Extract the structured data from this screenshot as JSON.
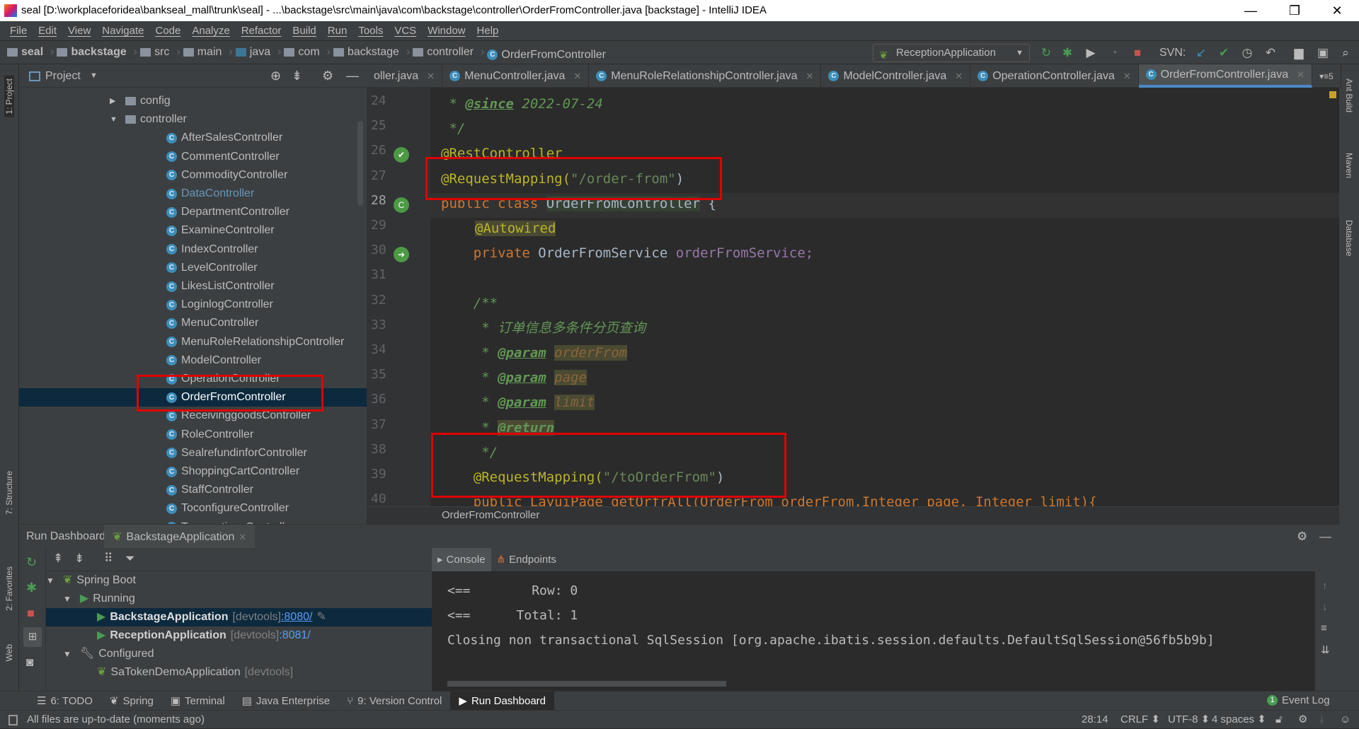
{
  "window": {
    "title": "seal [D:\\workplaceforidea\\bankseal_mall\\trunk\\seal] - ...\\backstage\\src\\main\\java\\com\\backstage\\controller\\OrderFromController.java [backstage] - IntelliJ IDEA",
    "minimize": "—",
    "restore": "❐",
    "close": "✕"
  },
  "menu": [
    "File",
    "Edit",
    "View",
    "Navigate",
    "Code",
    "Analyze",
    "Refactor",
    "Build",
    "Run",
    "Tools",
    "VCS",
    "Window",
    "Help"
  ],
  "breadcrumb": [
    "seal",
    "backstage",
    "src",
    "main",
    "java",
    "com",
    "backstage",
    "controller",
    "OrderFromController"
  ],
  "toolbar": {
    "run_config": "ReceptionApplication",
    "svn_label": "SVN:"
  },
  "left_strip": {
    "project": "1: Project",
    "structure": "7: Structure",
    "favorites": "2: Favorites",
    "web": "Web"
  },
  "right_strip": {
    "ant": "Ant Build",
    "maven": "Maven",
    "database": "Database"
  },
  "project_panel": {
    "title": "Project",
    "tree": [
      {
        "label": "config",
        "type": "folder",
        "depth": 1,
        "expanded": false
      },
      {
        "label": "controller",
        "type": "folder",
        "depth": 1,
        "expanded": true
      },
      {
        "label": "AfterSalesController",
        "type": "class",
        "depth": 2
      },
      {
        "label": "CommentController",
        "type": "class",
        "depth": 2
      },
      {
        "label": "CommodityController",
        "type": "class",
        "depth": 2
      },
      {
        "label": "DataController",
        "type": "class",
        "depth": 2,
        "color": "#6897bb"
      },
      {
        "label": "DepartmentController",
        "type": "class",
        "depth": 2
      },
      {
        "label": "ExamineController",
        "type": "class",
        "depth": 2
      },
      {
        "label": "IndexController",
        "type": "class",
        "depth": 2
      },
      {
        "label": "LevelController",
        "type": "class",
        "depth": 2
      },
      {
        "label": "LikesListController",
        "type": "class",
        "depth": 2
      },
      {
        "label": "LoginlogController",
        "type": "class",
        "depth": 2
      },
      {
        "label": "MenuController",
        "type": "class",
        "depth": 2
      },
      {
        "label": "MenuRoleRelationshipController",
        "type": "class",
        "depth": 2
      },
      {
        "label": "ModelController",
        "type": "class",
        "depth": 2
      },
      {
        "label": "OperationController",
        "type": "class",
        "depth": 2
      },
      {
        "label": "OrderFromController",
        "type": "class",
        "depth": 2,
        "selected": true
      },
      {
        "label": "ReceivinggoodsController",
        "type": "class",
        "depth": 2
      },
      {
        "label": "RoleController",
        "type": "class",
        "depth": 2
      },
      {
        "label": "SealrefundinforController",
        "type": "class",
        "depth": 2
      },
      {
        "label": "ShoppingCartController",
        "type": "class",
        "depth": 2
      },
      {
        "label": "StaffController",
        "type": "class",
        "depth": 2
      },
      {
        "label": "ToconfigureController",
        "type": "class",
        "depth": 2
      },
      {
        "label": "TransactionsController",
        "type": "class",
        "depth": 2
      }
    ]
  },
  "editor": {
    "tabs": [
      {
        "label": "oller.java"
      },
      {
        "label": "MenuController.java"
      },
      {
        "label": "MenuRoleRelationshipController.java"
      },
      {
        "label": "ModelController.java"
      },
      {
        "label": "OperationController.java"
      },
      {
        "label": "OrderFromController.java",
        "active": true
      }
    ],
    "tab_overflow": "▾≡5",
    "line_numbers": [
      "24",
      "25",
      "26",
      "27",
      "28",
      "29",
      "30",
      "31",
      "32",
      "33",
      "34",
      "35",
      "36",
      "37",
      "38",
      "39",
      "40"
    ],
    "code": {
      "l24a": " * ",
      "l24b": "@since",
      "l24c": " 2022-07-24",
      "l25": " */",
      "l26": "@RestController",
      "l27a": "@RequestMapping(",
      "l27b": "\"/order-from\"",
      "l27c": ")",
      "l28a": "public class ",
      "l28b": "OrderFromController",
      "l28c": " {",
      "l29": "@Autowired",
      "l30a": "    private ",
      "l30b": "OrderFromService ",
      "l30c": "orderFromService;",
      "l32": "    /**",
      "l33": "     * 订单信息多条件分页查询",
      "l34a": "     * ",
      "l34b": "@param",
      "l34c": "orderFrom",
      "l35a": "     * ",
      "l35b": "@param",
      "l35c": "page",
      "l36a": "     * ",
      "l36b": "@param",
      "l36c": "limit",
      "l37a": "     * ",
      "l37b": "@return",
      "l38": "     */",
      "l39a": "    @RequestMapping(",
      "l39b": "\"/toOrderFrom\"",
      "l39c": ")",
      "l40": "    public LayuiPage getOrfrAll(OrderFrom orderFrom,Integer page, Integer limit){"
    },
    "breadcrumb": "OrderFromController",
    "current_line": "28"
  },
  "run_dashboard": {
    "title": "Run Dashboard:",
    "tab": "BackstageApplication",
    "tree": {
      "spring_boot": "Spring Boot",
      "running": "Running",
      "apps": [
        {
          "name": "BackstageApplication",
          "tag": "[devtools]",
          "port": ":8080/",
          "selected": true
        },
        {
          "name": "ReceptionApplication",
          "tag": "[devtools]",
          "port": ":8081/"
        }
      ],
      "configured": "Configured",
      "configured_apps": [
        {
          "name": "SaTokenDemoApplication",
          "tag": "[devtools]"
        }
      ]
    },
    "console_tabs": [
      "Console",
      "Endpoints"
    ],
    "console_lines": [
      "<==        Row: 0",
      "<==      Total: 1",
      "Closing non transactional SqlSession [org.apache.ibatis.session.defaults.DefaultSqlSession@56fb5b9b]"
    ]
  },
  "bottom_tabs": [
    {
      "label": "6: TODO",
      "icon": "list-icon"
    },
    {
      "label": "Spring",
      "icon": "spring-leaf-icon"
    },
    {
      "label": "Terminal",
      "icon": "terminal-icon"
    },
    {
      "label": "Java Enterprise",
      "icon": "java-enterprise-icon"
    },
    {
      "label": "9: Version Control",
      "icon": "vcs-icon"
    },
    {
      "label": "Run Dashboard",
      "icon": "run-icon",
      "active": true
    }
  ],
  "event_log": {
    "count": "1",
    "label": "Event Log"
  },
  "status": {
    "message": "All files are up-to-date (moments ago)",
    "position": "28:14",
    "line_sep": "CRLF ⬍",
    "encoding": "UTF-8 ⬍",
    "indent": "4 spaces ⬍"
  },
  "colors": {
    "accent": "#4a88c7",
    "highlight_box": "#e00000",
    "selection": "#0d293e"
  }
}
